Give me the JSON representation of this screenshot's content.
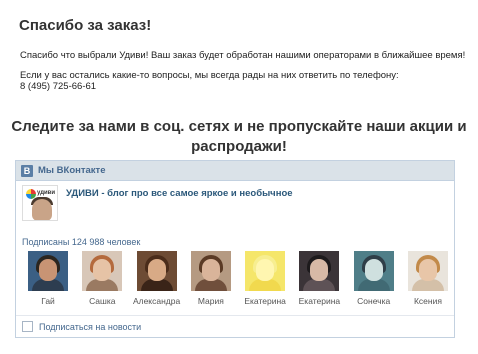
{
  "order": {
    "title": "Спасибо за заказ!",
    "message1": "Спасибо что выбрали Удиви! Ваш заказ будет обработан нашими операторами в ближайшее время!",
    "message2": "Если у вас остались какие-то вопросы, мы всегда рады на них ответить по телефону:",
    "phone": "8 (495) 725-66-61"
  },
  "follow_text": "Следите за нами в соц. сетях и не пропускайте наши акции и распродажи!",
  "widget": {
    "logo_letter": "В",
    "header": "Мы ВКонтакте",
    "group_name": "УДИВИ - блог про все самое яркое и необычное",
    "group_logo_text": "удиви",
    "subscribers": "Подписаны 124 988 человек",
    "members": [
      {
        "name": "Гай",
        "bg": "#3b5f84",
        "skin": "#c89474",
        "hair": "#2b2620",
        "cloth": "#2d3d50"
      },
      {
        "name": "Сашка",
        "bg": "#d8c7b8",
        "skin": "#e6c3a6",
        "hair": "#b46a3d",
        "cloth": "#9a7a62"
      },
      {
        "name": "Александра",
        "bg": "#6d4b34",
        "skin": "#d8aa86",
        "hair": "#4a2c1a",
        "cloth": "#3a2418"
      },
      {
        "name": "Мария",
        "bg": "#b59a82",
        "skin": "#d9b49a",
        "hair": "#5a3a25",
        "cloth": "#704f3c"
      },
      {
        "name": "Екатерина",
        "bg": "#f5e66a",
        "skin": "#fff6b0",
        "hair": "#f7ee90",
        "cloth": "#f1d94e"
      },
      {
        "name": "Екатерина",
        "bg": "#3b3438",
        "skin": "#d7b9a6",
        "hair": "#1d1a1c",
        "cloth": "#5e5256"
      },
      {
        "name": "Сонечка",
        "bg": "#4f7e88",
        "skin": "#cfe0df",
        "hair": "#2f3e48",
        "cloth": "#416a74"
      },
      {
        "name": "Ксения",
        "bg": "#e9e4dc",
        "skin": "#e8c6a8",
        "hair": "#c28a4a",
        "cloth": "#d4c0a8"
      }
    ],
    "subscribe_label": "Подписаться на новости"
  }
}
